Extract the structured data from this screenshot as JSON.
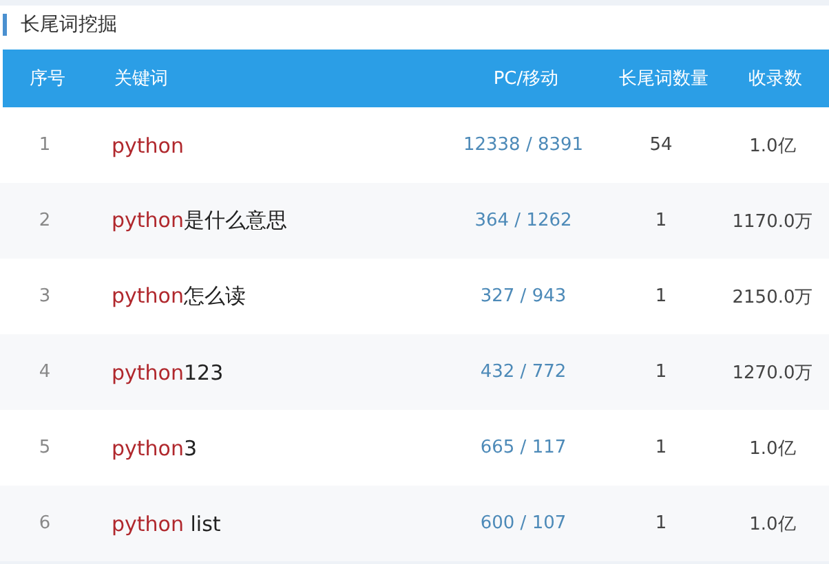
{
  "section_title": "长尾词挖掘",
  "table": {
    "columns": [
      "序号",
      "关键词",
      "PC/移动",
      "长尾词数量",
      "收录数"
    ],
    "rows": [
      {
        "index": "1",
        "keyword_match": "python",
        "keyword_rest": "",
        "pc_mobile": "12338 / 8391",
        "longtail_count": "54",
        "indexed": "1.0亿"
      },
      {
        "index": "2",
        "keyword_match": "python",
        "keyword_rest": "是什么意思",
        "pc_mobile": "364 / 1262",
        "longtail_count": "1",
        "indexed": "1170.0万"
      },
      {
        "index": "3",
        "keyword_match": "python",
        "keyword_rest": "怎么读",
        "pc_mobile": "327 / 943",
        "longtail_count": "1",
        "indexed": "2150.0万"
      },
      {
        "index": "4",
        "keyword_match": "python",
        "keyword_rest": "123",
        "pc_mobile": "432 / 772",
        "longtail_count": "1",
        "indexed": "1270.0万"
      },
      {
        "index": "5",
        "keyword_match": "python",
        "keyword_rest": "3",
        "pc_mobile": "665 / 117",
        "longtail_count": "1",
        "indexed": "1.0亿"
      },
      {
        "index": "6",
        "keyword_match": "python",
        "keyword_rest": " list",
        "pc_mobile": "600 / 107",
        "longtail_count": "1",
        "indexed": "1.0亿"
      }
    ]
  }
}
